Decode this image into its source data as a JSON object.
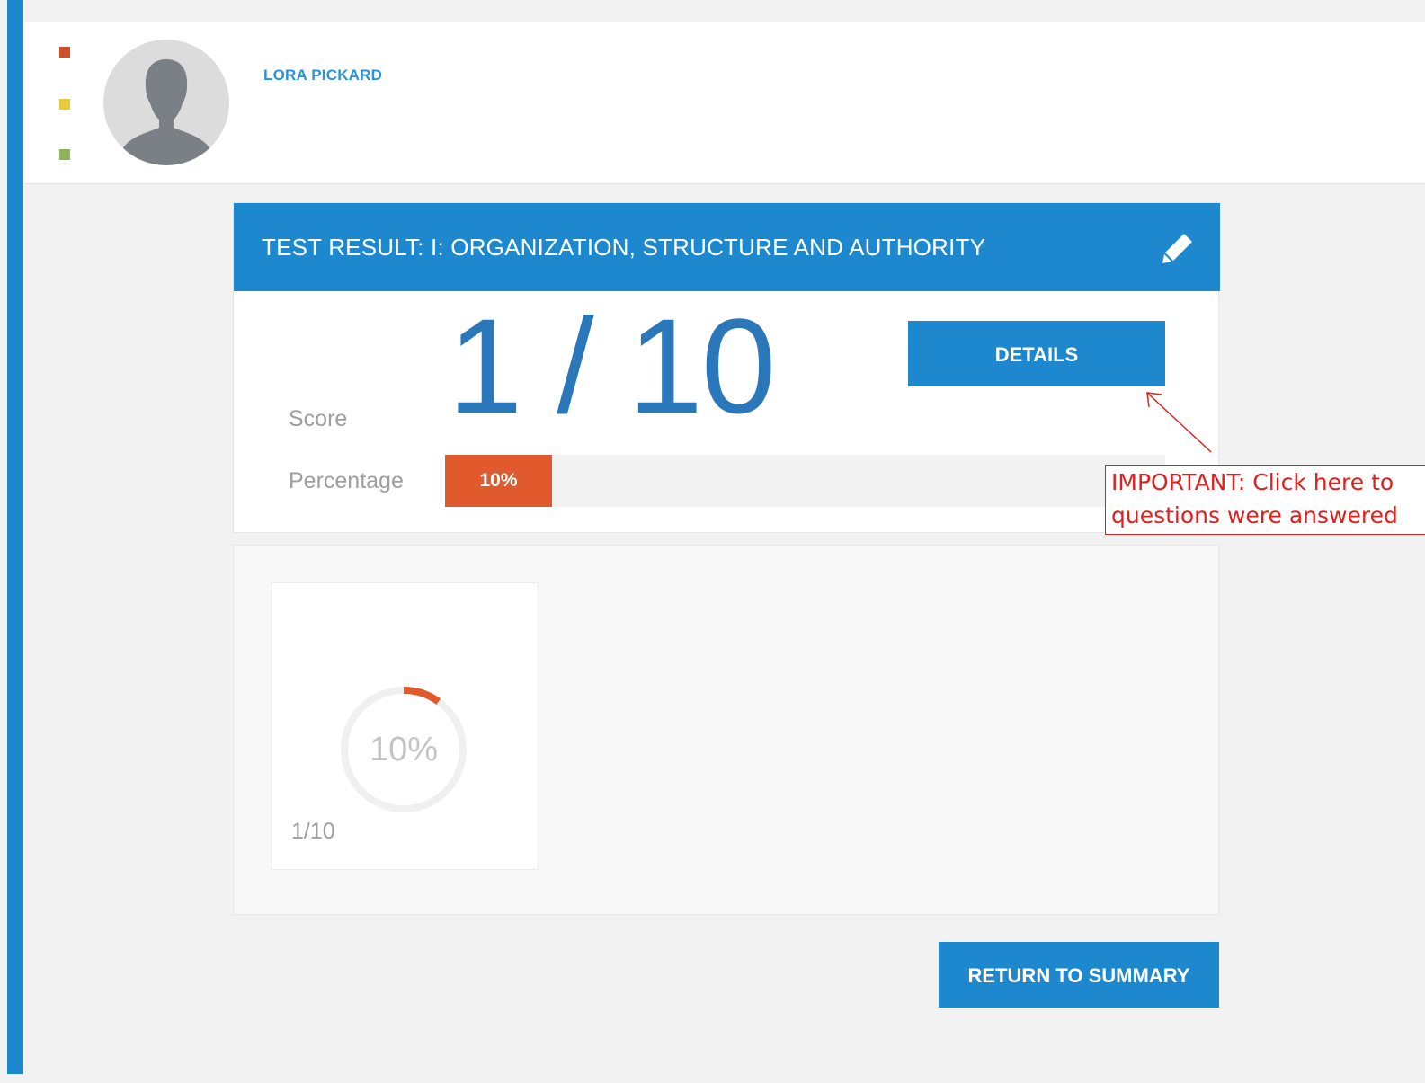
{
  "profile": {
    "user_name": "LORA PICKARD",
    "status_dots": [
      "#d0502a",
      "#e8c93a",
      "#8db35b"
    ]
  },
  "result": {
    "title": "TEST RESULT: I: ORGANIZATION, STRUCTURE AND AUTHORITY",
    "edit_icon": "pencil-icon",
    "score_label": "Score",
    "score_value": "1 / 10",
    "details_label": "DETAILS",
    "percentage_label": "Percentage",
    "percentage_text": "10%",
    "percentage_value": 10
  },
  "chart_tile": {
    "donut_percent": 10,
    "donut_label": "10%",
    "ratio": "1/10",
    "colors": {
      "fill": "#e05a2e",
      "track": "#f0f0f0"
    }
  },
  "footer": {
    "return_label": "RETURN TO SUMMARY"
  },
  "annotation": {
    "line1": "IMPORTANT: Click here to",
    "line2": "questions were answered"
  },
  "colors": {
    "primary": "#1e88cf",
    "accent": "#e05a2e",
    "annotation": "#e0201c"
  }
}
